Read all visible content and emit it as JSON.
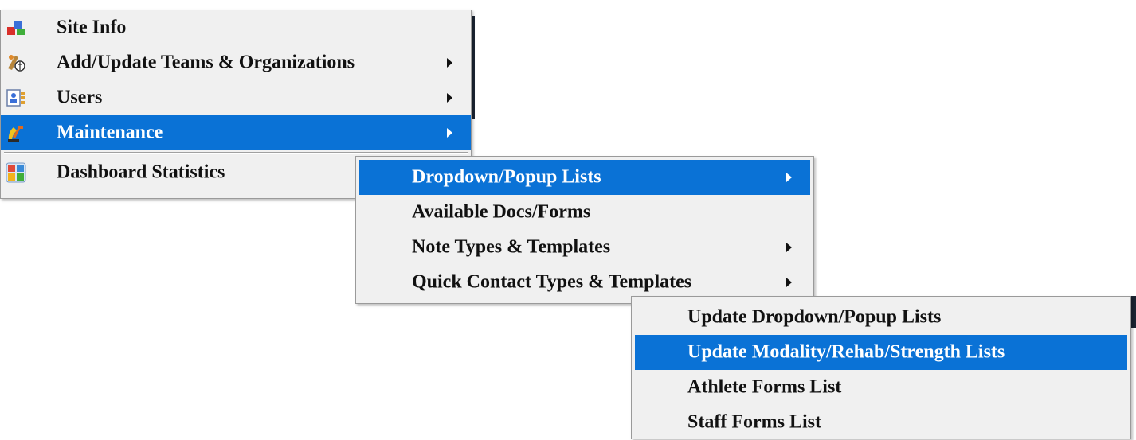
{
  "main_menu": {
    "items": [
      {
        "label": "Site Info",
        "icon": "site-info-icon",
        "has_submenu": false
      },
      {
        "label": "Add/Update Teams & Organizations",
        "icon": "teams-icon",
        "has_submenu": true
      },
      {
        "label": "Users",
        "icon": "users-icon",
        "has_submenu": true
      },
      {
        "label": "Maintenance",
        "icon": "maintenance-icon",
        "has_submenu": true,
        "selected": true
      },
      {
        "label": "Dashboard Statistics",
        "icon": "dashboard-icon",
        "has_submenu": false
      }
    ]
  },
  "maintenance_menu": {
    "items": [
      {
        "label": "Dropdown/Popup Lists",
        "has_submenu": true,
        "selected": true
      },
      {
        "label": "Available Docs/Forms",
        "has_submenu": false
      },
      {
        "label": "Note Types & Templates",
        "has_submenu": true
      },
      {
        "label": "Quick Contact Types & Templates",
        "has_submenu": true
      }
    ]
  },
  "lists_menu": {
    "items": [
      {
        "label": "Update Dropdown/Popup Lists"
      },
      {
        "label": "Update Modality/Rehab/Strength Lists",
        "selected": true
      },
      {
        "label": "Athlete Forms List"
      },
      {
        "label": "Staff Forms List"
      }
    ]
  },
  "colors": {
    "selection": "#0a72d6",
    "menu_background": "#f0f0f0"
  }
}
